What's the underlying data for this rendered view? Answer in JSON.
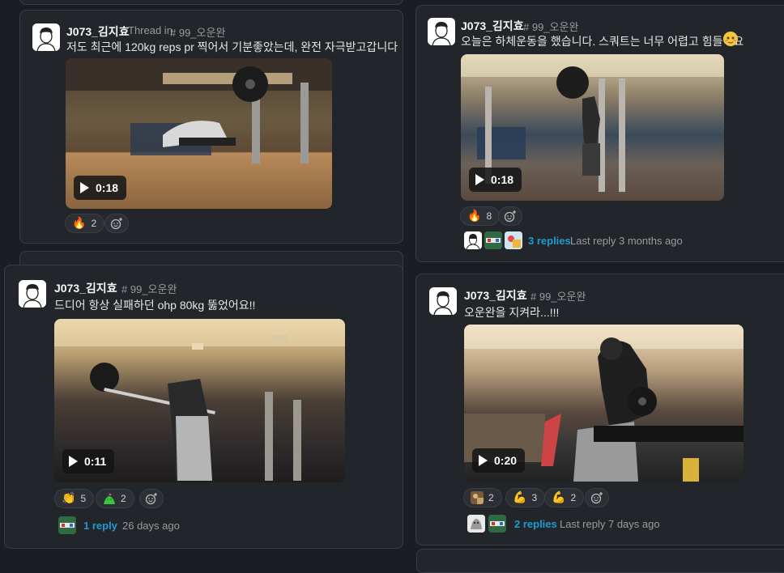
{
  "posts": [
    {
      "username": "J073_김지효",
      "thread_label": "Thread in",
      "channel": "# 99_오운완",
      "text": "저도 최근에 120kg reps pr 찍어서 기분좋았는데, 완전 자극받고갑니다",
      "video_duration": "0:18",
      "reactions": [
        {
          "icon": "fire-emoji",
          "glyph": "🔥",
          "count": "2"
        }
      ]
    },
    {
      "username": "J073_김지효",
      "channel": "# 99_오운완",
      "text": "오늘은 하체운동을 했습니다. 스쿼트는 너무 어렵고 힘들어요",
      "video_duration": "0:18",
      "reactions": [
        {
          "icon": "fire-emoji",
          "glyph": "🔥",
          "count": "8"
        }
      ],
      "replies_label": "3 replies",
      "last_reply": "Last reply 3 months ago"
    },
    {
      "username": "J073_김지효",
      "channel": "# 99_오운완",
      "text": "드디어 항상 실패하던 ohp 80kg 뚫었어요!!",
      "video_duration": "0:11",
      "reactions": [
        {
          "icon": "clap-emoji",
          "glyph": "👏",
          "count": "5"
        },
        {
          "icon": "party-blob-emoji",
          "glyph": "",
          "count": "2"
        }
      ],
      "replies_label": "1 reply",
      "last_reply": "26 days ago"
    },
    {
      "username": "J073_김지효",
      "channel": "# 99_오운완",
      "text": "오운완을 지켜라...!!!",
      "video_duration": "0:20",
      "reactions": [
        {
          "icon": "custom-photo-emoji",
          "glyph": "",
          "count": "2"
        },
        {
          "icon": "flexed-biceps-emoji",
          "glyph": "💪",
          "count": "3"
        },
        {
          "icon": "flexed-biceps-emoji",
          "glyph": "💪",
          "count": "2"
        }
      ],
      "replies_label": "2 replies",
      "last_reply": "Last reply 7 days ago"
    }
  ],
  "colors": {
    "link": "#1d9bd1",
    "card": "#222529",
    "background": "#1a1d21"
  }
}
